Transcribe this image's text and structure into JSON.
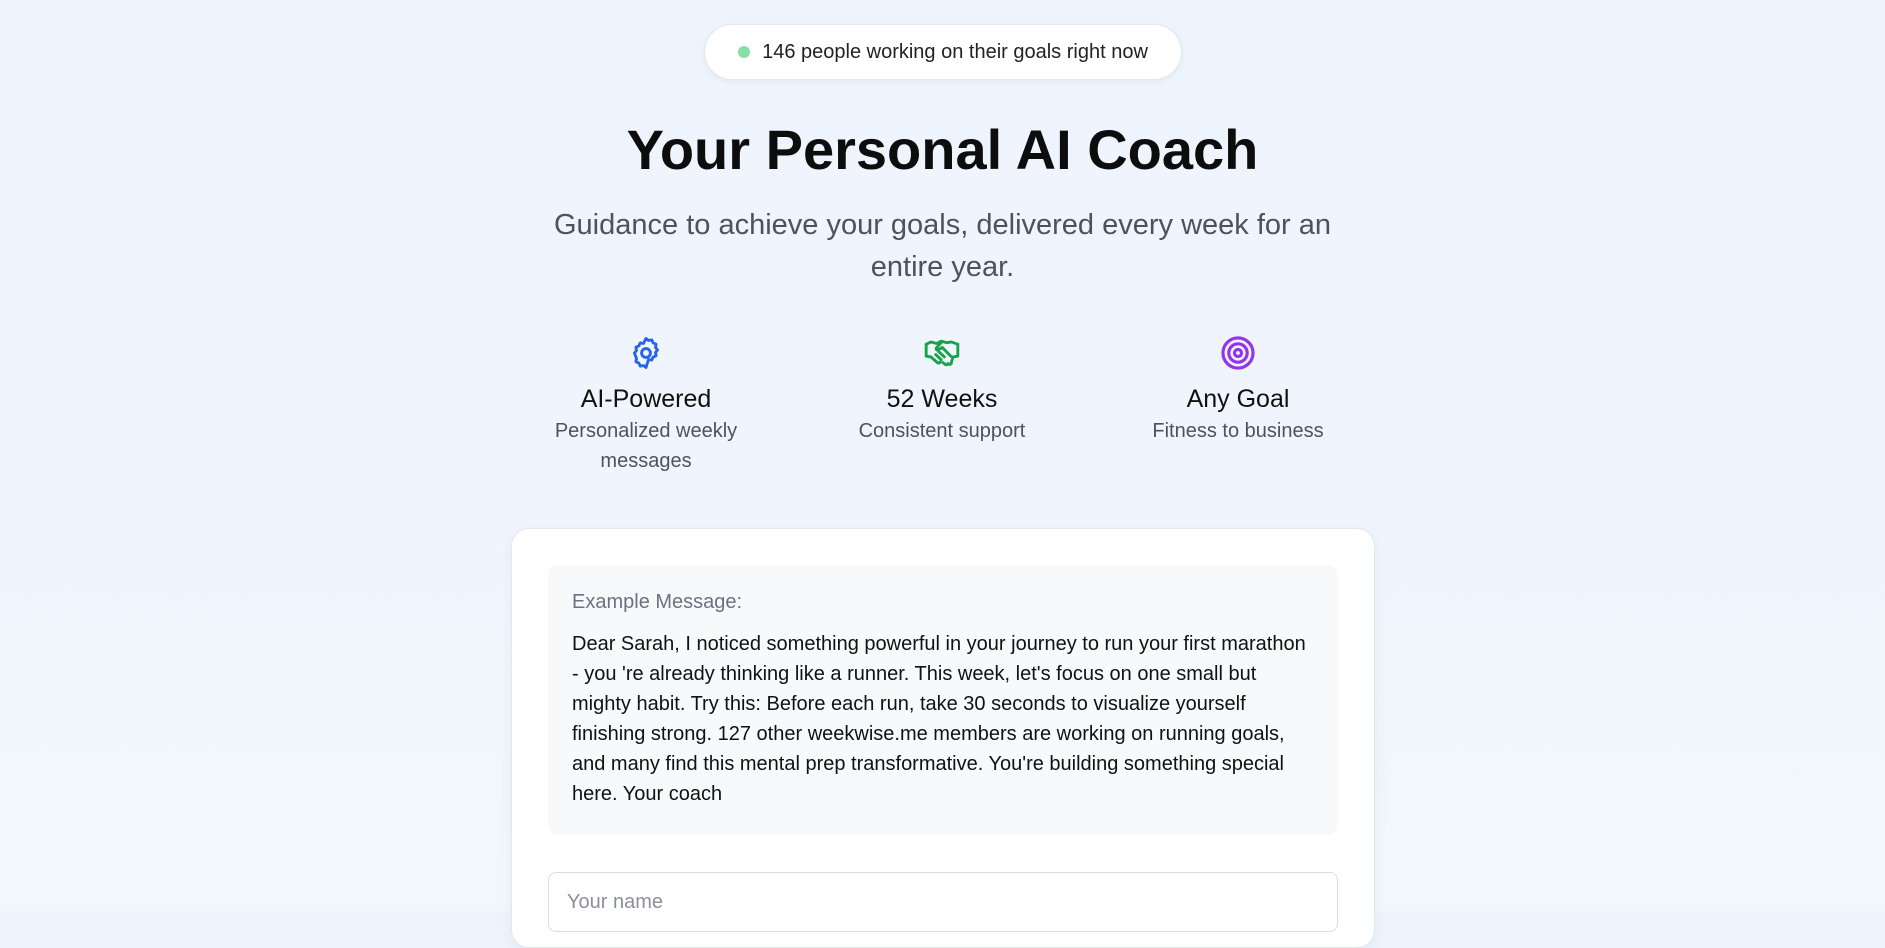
{
  "status": {
    "text": "146 people working on their goals right now",
    "dot_color": "#86e0a8"
  },
  "hero": {
    "title": "Your Personal AI Coach",
    "subtitle": "Guidance to achieve your goals, delivered every week for an entire year."
  },
  "features": [
    {
      "icon": "gear-icon",
      "color": "#2563eb",
      "title": "AI-Powered",
      "desc": "Personalized weekly messages"
    },
    {
      "icon": "handshake-icon",
      "color": "#16a34a",
      "title": "52 Weeks",
      "desc": "Consistent support"
    },
    {
      "icon": "target-icon",
      "color": "#9333ea",
      "title": "Any Goal",
      "desc": "Fitness to business"
    }
  ],
  "example": {
    "label": "Example Message:",
    "body": "Dear Sarah, I noticed something powerful in your journey to run your first marathon - you 're already thinking like a runner. This week, let's focus on one small but mighty habit. Try this: Before each run, take 30 seconds to visualize yourself finishing strong. 127 other weekwise.me members are working on running goals, and many find this mental prep transformative. You're building something special here. Your coach"
  },
  "form": {
    "name_placeholder": "Your name",
    "name_value": ""
  }
}
